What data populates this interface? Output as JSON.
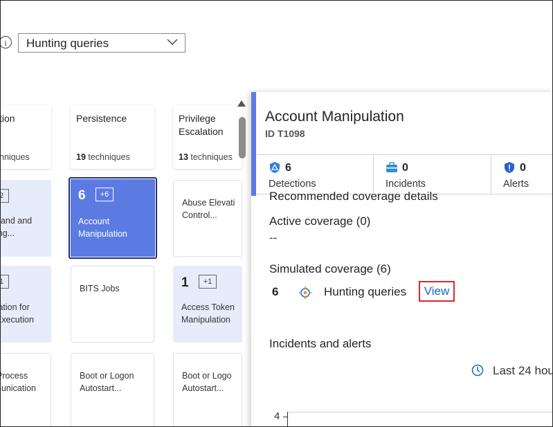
{
  "filter": {
    "info_glyph": "i",
    "dropdown_value": "Hunting queries"
  },
  "matrix": {
    "headers": [
      {
        "title": "tion",
        "count": "",
        "unit": "nniques"
      },
      {
        "title": "Persistence",
        "count": "19",
        "unit": " techniques"
      },
      {
        "title": "Privilege\nEscalation",
        "count": "13",
        "unit": " techniques"
      }
    ],
    "row1": {
      "col0_badge": "2",
      "col0_text": [
        "hand and",
        "ing..."
      ],
      "col1_count": "6",
      "col1_badge": "+6",
      "col1_text": [
        "Account",
        "Manipulation"
      ],
      "col2_text": [
        "Abuse Elevati",
        "Control..."
      ]
    },
    "row2": {
      "col0_badge": "1",
      "col0_text": [
        "tation for",
        " Execution"
      ],
      "col1_text": [
        "BITS Jobs"
      ],
      "col2_count": "1",
      "col2_badge": "+1",
      "col2_text": [
        "Access Token",
        "Manipulation"
      ]
    },
    "row3": {
      "col0_text": [
        "Process",
        "nunication"
      ],
      "col1_text": [
        "Boot or Logon",
        "Autostart..."
      ],
      "col2_text": [
        "Boot or Logo",
        "Autostart..."
      ]
    }
  },
  "panel": {
    "title": "Account Manipulation",
    "id_label": "ID T1098",
    "stats": [
      {
        "value": "6",
        "label": "Detections",
        "icon": "detection-shield-icon"
      },
      {
        "value": "0",
        "label": "Incidents",
        "icon": "incident-briefcase-icon"
      },
      {
        "value": "0",
        "label": "Alerts",
        "icon": "alert-shield-icon"
      }
    ],
    "recommended_heading": "Recommended coverage details",
    "active_coverage": "Active coverage (0)",
    "active_empty": "--",
    "simulated_coverage": "Simulated coverage (6)",
    "sim_count": "6",
    "sim_source": "Hunting queries",
    "view_link": "View",
    "incidents_heading": "Incidents and alerts",
    "time_range": "Last 24 hou",
    "axis_value": "4"
  },
  "colors": {
    "accent": "#5b7be2",
    "selected_tile": "#5b7be2",
    "light_tile": "#e7ecfb",
    "link": "#1467c8",
    "highlight_box": "#e0262b"
  }
}
